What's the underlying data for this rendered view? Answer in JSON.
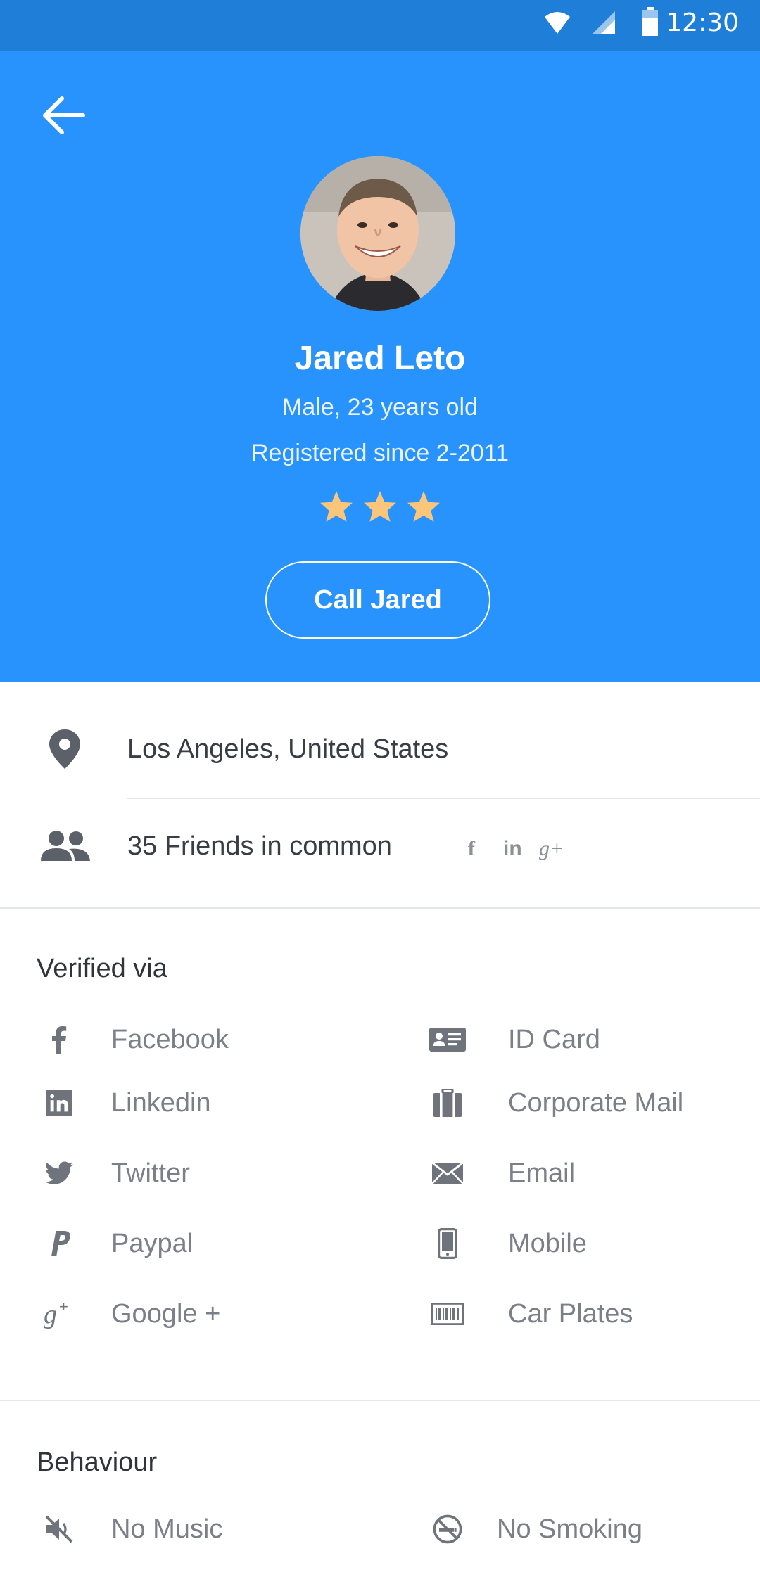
{
  "status_bar": {
    "time": "12:30"
  },
  "header": {
    "name": "Jared Leto",
    "gender_age": "Male, 23 years old",
    "registered": "Registered since 2-2011",
    "rating": 3,
    "call_label": "Call Jared"
  },
  "info": {
    "location": "Los Angeles, United States",
    "friends": "35 Friends in common",
    "social": {
      "facebook": "f",
      "linkedin": "in",
      "google": "g+"
    }
  },
  "verified": {
    "title": "Verified via",
    "left": [
      "Facebook",
      "Linkedin",
      "Twitter",
      "Paypal",
      "Google +"
    ],
    "right": [
      "ID Card",
      "Corporate Mail",
      "Email",
      "Mobile",
      "Car Plates"
    ]
  },
  "behaviour": {
    "title": "Behaviour",
    "items": [
      "No Music",
      "No Smoking"
    ]
  },
  "colors": {
    "header_blue": "#2893fc",
    "status_blue": "#1f7fd8",
    "star": "#fbc67a",
    "icon_grey": "#6f747c"
  }
}
